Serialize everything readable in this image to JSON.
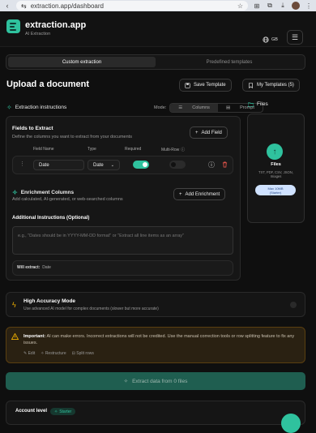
{
  "browser": {
    "url": "extraction.app/dashboard"
  },
  "header": {
    "brand": "extraction.app",
    "subtitle": "AI Extraction",
    "language": "GB"
  },
  "tabs": [
    {
      "label": "Custom extraction",
      "active": true
    },
    {
      "label": "Predefined templates",
      "active": false
    }
  ],
  "page": {
    "title": "Upload a document",
    "save_template": "Save Template",
    "my_templates": "My Templates (5)"
  },
  "instructions": {
    "title": "Extraction instructions",
    "mode_label": "Mode:",
    "mode_columns": "Columns",
    "mode_prompt": "Prompt"
  },
  "fields": {
    "title": "Fields to Extract",
    "description": "Define the columns you want to extract from your documents",
    "add_field": "Add Field",
    "headers": {
      "name": "Field Name",
      "type": "Type",
      "required": "Required",
      "multirow": "Multi-Row"
    },
    "rows": [
      {
        "name": "Date",
        "type": "Date",
        "required": true,
        "multirow": false
      }
    ]
  },
  "enrichment": {
    "title": "Enrichment Columns",
    "description": "Add calculated, AI-generated, or web-searched columns",
    "add_label": "Add Enrichment"
  },
  "additional": {
    "title": "Additional Instructions (Optional)",
    "placeholder": "e.g., \"Dates should be in YYYY-MM-DD format\" or \"Extract all line items as an array\"",
    "will_extract_label": "Will extract:",
    "will_extract_value": "Date"
  },
  "files": {
    "title": "Files",
    "drop_title": "Files",
    "formats": "TXT, PDF, CSV, JSON, Images",
    "limit_line1": "Max 10MB",
    "limit_line2": "(Starter)"
  },
  "high_accuracy": {
    "title": "High Accuracy Mode",
    "description": "Use advanced AI model for complex documents (slower but more accurate)"
  },
  "warning": {
    "bold": "Important:",
    "text": "AI can make errors. Incorrect extractions will not be credited. Use the manual correction tools or row splitting feature to fix any issues.",
    "tools": [
      "Edit",
      "Restructure",
      "Split rows"
    ]
  },
  "extract_button": "Extract data from 0 files",
  "account": {
    "label": "Account level",
    "plan": "Starter"
  },
  "colors": {
    "accent": "#2fc29e",
    "background": "#0f0f0f",
    "panel": "#161616",
    "warning_bg": "#2a2112",
    "delete": "#e0534a"
  },
  "icons": {
    "logo": "document-lines-icon",
    "globe": "globe-icon",
    "menu": "hamburger-icon",
    "save": "save-icon",
    "templates": "bookmark-icon",
    "sparkle": "sparkle-icon",
    "folder": "folder-icon",
    "upload": "upload-icon",
    "lightning": "lightning-icon",
    "warning": "warning-icon"
  }
}
